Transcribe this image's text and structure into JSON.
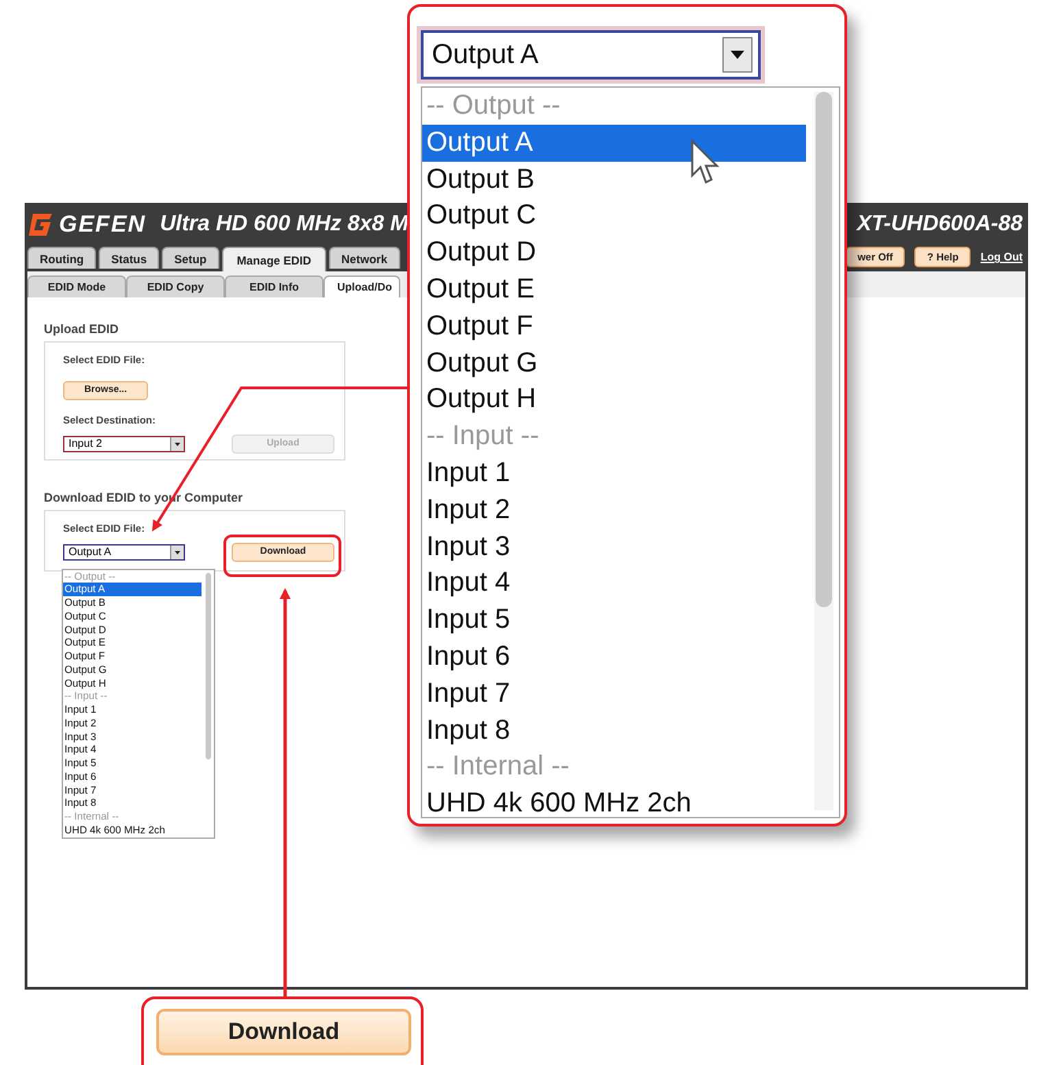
{
  "header": {
    "logo": "GEFEN",
    "title_left": "Ultra HD 600 MHz 8x8 M",
    "title_right": "XT-UHD600A-88",
    "buttons": [
      {
        "label": "wer Off",
        "kind": "button"
      },
      {
        "label": "? Help",
        "kind": "button"
      },
      {
        "label": "Log Out",
        "kind": "link"
      }
    ]
  },
  "tabs": [
    {
      "label": "Routing",
      "selected": false
    },
    {
      "label": "Status",
      "selected": false
    },
    {
      "label": "Setup",
      "selected": false
    },
    {
      "label": "Manage EDID",
      "selected": true
    },
    {
      "label": "Network",
      "selected": false
    }
  ],
  "subtabs": [
    {
      "label": "EDID Mode",
      "selected": false
    },
    {
      "label": "EDID Copy",
      "selected": false
    },
    {
      "label": "EDID Info",
      "selected": false
    },
    {
      "label": "Upload/Do",
      "selected": true
    }
  ],
  "upload": {
    "title": "Upload EDID",
    "file_label": "Select EDID File:",
    "browse": "Browse...",
    "dest_label": "Select Destination:",
    "dest_value": "Input 2",
    "button": {
      "label": "Upload",
      "disabled": true
    }
  },
  "download": {
    "title": "Download EDID to your Computer",
    "file_label": "Select EDID File:",
    "file_value": "Output A",
    "button": {
      "label": "Download",
      "disabled": false
    },
    "options": [
      {
        "label": "-- Output --",
        "kind": "group",
        "selected": false
      },
      {
        "label": "Output A",
        "kind": "option",
        "selected": true
      },
      {
        "label": "Output B",
        "kind": "option",
        "selected": false
      },
      {
        "label": "Output C",
        "kind": "option",
        "selected": false
      },
      {
        "label": "Output D",
        "kind": "option",
        "selected": false
      },
      {
        "label": "Output E",
        "kind": "option",
        "selected": false
      },
      {
        "label": "Output F",
        "kind": "option",
        "selected": false
      },
      {
        "label": "Output G",
        "kind": "option",
        "selected": false
      },
      {
        "label": "Output H",
        "kind": "option",
        "selected": false
      },
      {
        "label": "-- Input --",
        "kind": "group",
        "selected": false
      },
      {
        "label": "Input 1",
        "kind": "option",
        "selected": false
      },
      {
        "label": "Input 2",
        "kind": "option",
        "selected": false
      },
      {
        "label": "Input 3",
        "kind": "option",
        "selected": false
      },
      {
        "label": "Input 4",
        "kind": "option",
        "selected": false
      },
      {
        "label": "Input 5",
        "kind": "option",
        "selected": false
      },
      {
        "label": "Input 6",
        "kind": "option",
        "selected": false
      },
      {
        "label": "Input 7",
        "kind": "option",
        "selected": false
      },
      {
        "label": "Input 8",
        "kind": "option",
        "selected": false
      },
      {
        "label": "-- Internal --",
        "kind": "group",
        "selected": false
      },
      {
        "label": "UHD 4k 600 MHz 2ch",
        "kind": "option",
        "selected": false
      }
    ]
  },
  "zoom_callout": {
    "select_value": "Output A",
    "options": [
      {
        "label": "-- Output --",
        "kind": "group",
        "selected": false
      },
      {
        "label": "Output A",
        "kind": "option",
        "selected": true
      },
      {
        "label": "Output B",
        "kind": "option",
        "selected": false
      },
      {
        "label": "Output C",
        "kind": "option",
        "selected": false
      },
      {
        "label": "Output D",
        "kind": "option",
        "selected": false
      },
      {
        "label": "Output E",
        "kind": "option",
        "selected": false
      },
      {
        "label": "Output F",
        "kind": "option",
        "selected": false
      },
      {
        "label": "Output G",
        "kind": "option",
        "selected": false
      },
      {
        "label": "Output H",
        "kind": "option",
        "selected": false
      },
      {
        "label": "-- Input --",
        "kind": "group",
        "selected": false
      },
      {
        "label": "Input 1",
        "kind": "option",
        "selected": false
      },
      {
        "label": "Input 2",
        "kind": "option",
        "selected": false
      },
      {
        "label": "Input 3",
        "kind": "option",
        "selected": false
      },
      {
        "label": "Input 4",
        "kind": "option",
        "selected": false
      },
      {
        "label": "Input 5",
        "kind": "option",
        "selected": false
      },
      {
        "label": "Input 6",
        "kind": "option",
        "selected": false
      },
      {
        "label": "Input 7",
        "kind": "option",
        "selected": false
      },
      {
        "label": "Input 8",
        "kind": "option",
        "selected": false
      },
      {
        "label": "-- Internal --",
        "kind": "group",
        "selected": false
      },
      {
        "label": "UHD 4k 600 MHz 2ch",
        "kind": "option",
        "selected": false
      }
    ]
  },
  "button_callout": {
    "label": "Download"
  }
}
